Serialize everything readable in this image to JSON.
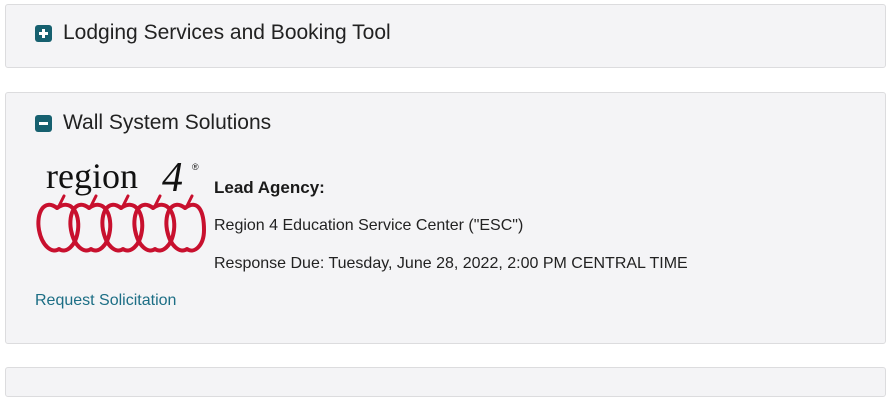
{
  "accordion": {
    "panels": [
      {
        "title": "Lodging Services and Booking Tool",
        "state": "collapsed",
        "icon": "plus-square-icon"
      },
      {
        "title": "Wall System Solutions",
        "state": "expanded",
        "icon": "minus-square-icon",
        "logo": {
          "text": "region",
          "number": "4",
          "registered": "®",
          "icon": "apples-logo"
        },
        "lead_agency_label": "Lead Agency:",
        "agency_name": "Region 4 Education Service Center (\"ESC\")",
        "response_due": "Response Due: Tuesday, June 28, 2022, 2:00 PM CENTRAL TIME",
        "link_label": "Request Solicitation"
      }
    ]
  },
  "colors": {
    "panel_background": "#f4f4f6",
    "panel_border": "#dcdcde",
    "toggle_icon": "#16606f",
    "link": "#1c6e85",
    "logo_apple": "#c8102e"
  }
}
